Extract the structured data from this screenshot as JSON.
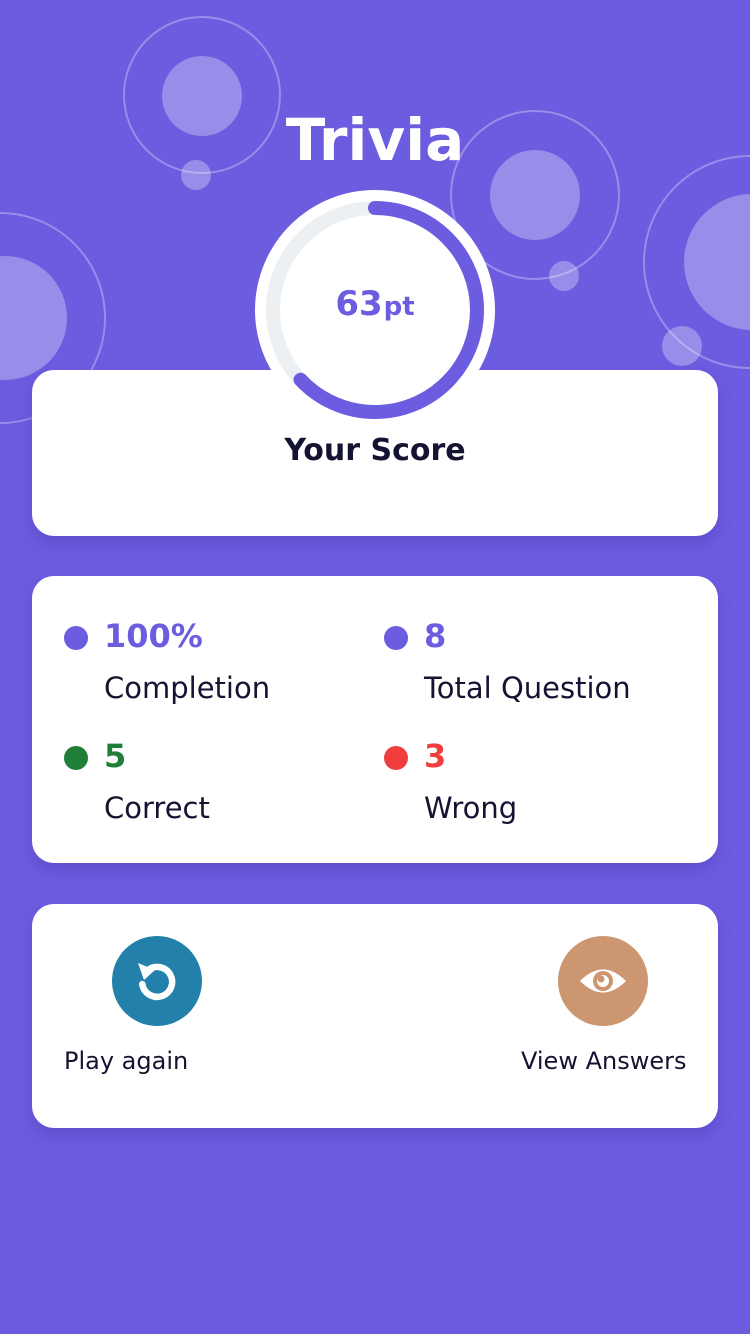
{
  "app": {
    "title": "Trivia"
  },
  "score": {
    "value": "63",
    "unit": "pt",
    "label": "Your Score",
    "progress_fraction": 0.63
  },
  "stats": {
    "completion": {
      "value": "100%",
      "label": "Completion",
      "color": "#6c5ce0"
    },
    "total": {
      "value": "8",
      "label": "Total Question",
      "color": "#6c5ce0"
    },
    "correct": {
      "value": "5",
      "label": "Correct",
      "color": "#1f7f37"
    },
    "wrong": {
      "value": "3",
      "label": "Wrong",
      "color": "#f03e3e"
    }
  },
  "actions": {
    "play_again": {
      "label": "Play again",
      "icon": "replay-icon",
      "color": "#2380aa"
    },
    "view_answers": {
      "label": "View Answers",
      "icon": "eye-icon",
      "color": "#cc9671"
    }
  },
  "colors": {
    "background": "#6c5ce0",
    "accent": "#6c5ce0",
    "card": "#ffffff",
    "text": "#141332"
  }
}
